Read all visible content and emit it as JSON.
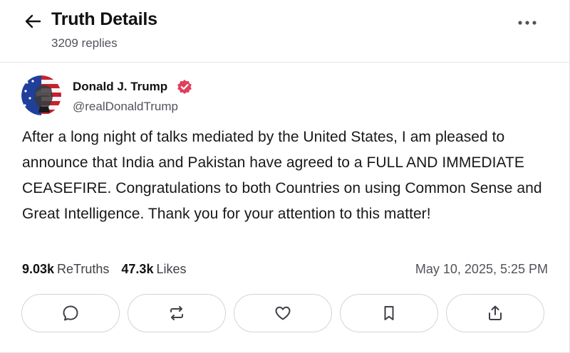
{
  "header": {
    "title": "Truth Details",
    "reply_count": "3209 replies",
    "back_icon": "arrow-left-icon",
    "more_icon": "more-horizontal-icon"
  },
  "post": {
    "author": {
      "name": "Donald J. Trump",
      "handle": "@realDonaldTrump",
      "verified": true,
      "verified_color": "#e0405a"
    },
    "text": "After a long night of talks mediated by the United States, I am pleased to announce that India and Pakistan have agreed to a FULL AND IMMEDIATE CEASEFIRE. Congratulations to both Countries on using Common Sense and Great Intelligence. Thank you for your attention to this matter!",
    "stats": {
      "retruths_count": "9.03k",
      "retruths_label": "ReTruths",
      "likes_count": "47.3k",
      "likes_label": "Likes"
    },
    "timestamp": "May 10, 2025, 5:25 PM"
  },
  "actions": [
    {
      "name": "reply",
      "icon": "comment-icon"
    },
    {
      "name": "retruth",
      "icon": "repost-icon"
    },
    {
      "name": "like",
      "icon": "heart-icon"
    },
    {
      "name": "bookmark",
      "icon": "bookmark-icon"
    },
    {
      "name": "share",
      "icon": "share-icon"
    }
  ],
  "colors": {
    "text_primary": "#111111",
    "text_secondary": "#52525b",
    "border": "#d4d4d8"
  }
}
